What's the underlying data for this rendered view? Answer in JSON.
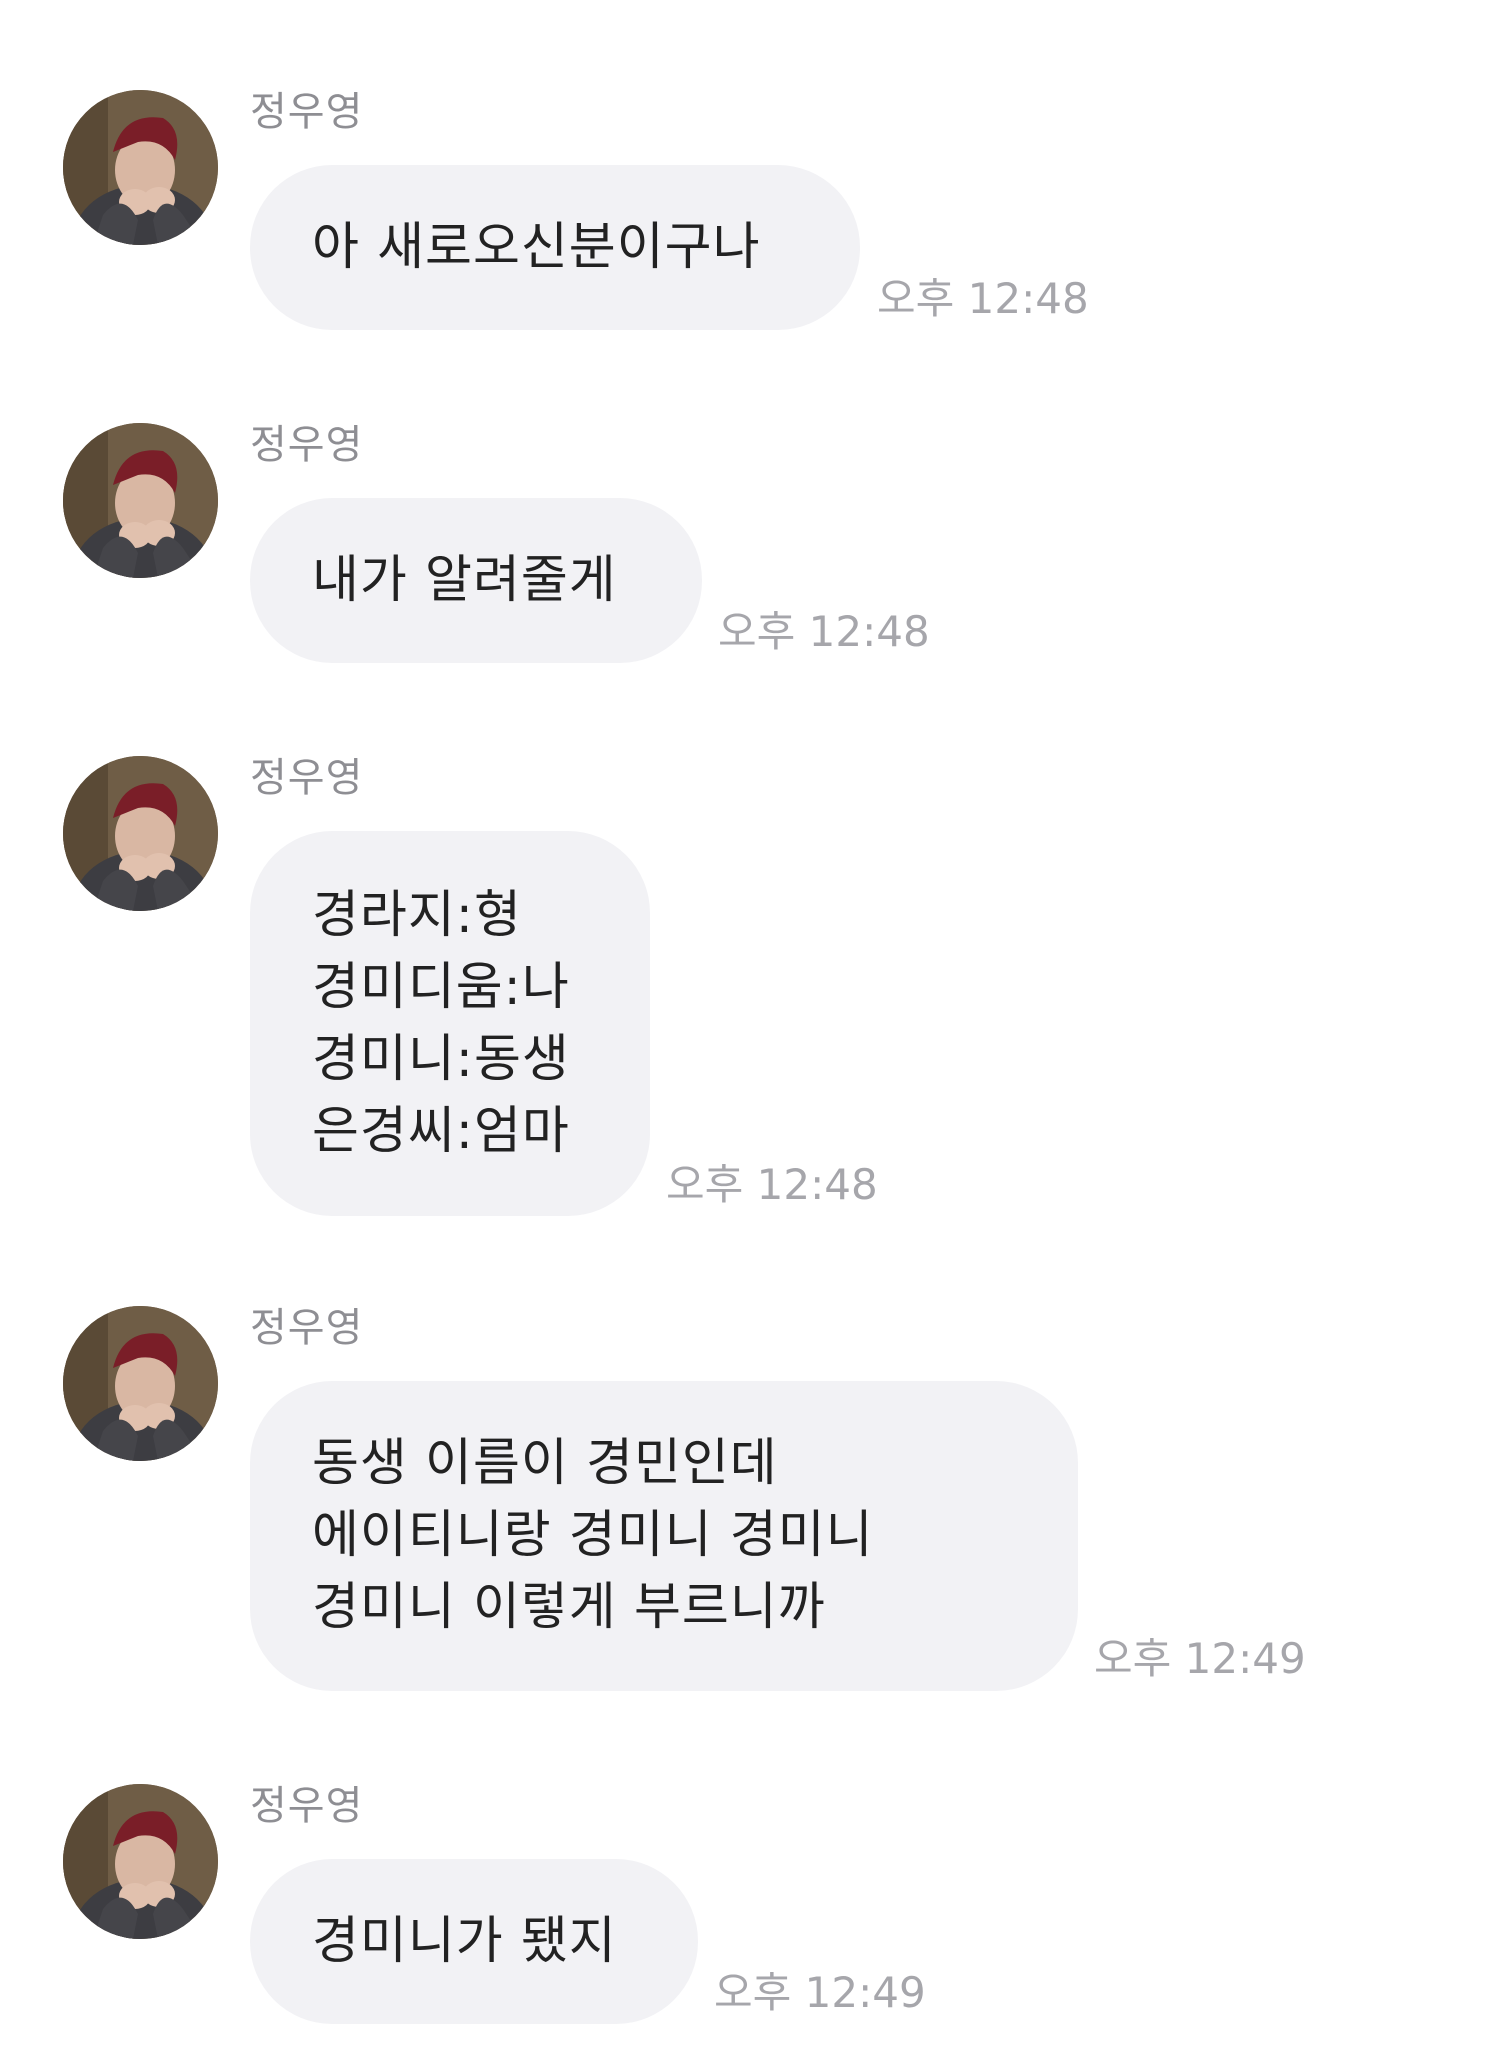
{
  "messages": [
    {
      "sender": "정우영",
      "text": "아 새로오신분이구나",
      "time": "오후 12:48"
    },
    {
      "sender": "정우영",
      "text": "내가 알려줄게",
      "time": "오후 12:48"
    },
    {
      "sender": "정우영",
      "text": "경라지:형\n경미디움:나\n경미니:동생\n은경씨:엄마",
      "time": "오후 12:48"
    },
    {
      "sender": "정우영",
      "text": "동생 이름이 경민인데\n에이티니랑 경미니 경미니\n경미니 이렇게 부르니까",
      "time": "오후 12:49"
    },
    {
      "sender": "정우영",
      "text": "경미니가 됐지",
      "time": "오후 12:49"
    }
  ],
  "avatar_icon": "profile-photo"
}
